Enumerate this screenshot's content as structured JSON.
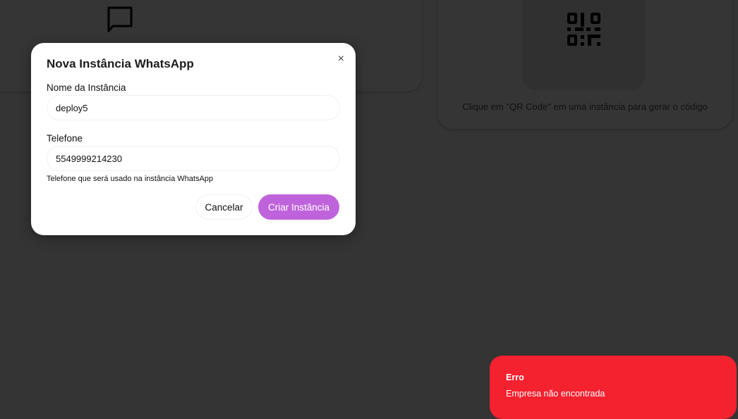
{
  "background": {
    "qr_hint": "Clique em \"QR Code\" em uma instância para gerar o código"
  },
  "modal": {
    "title": "Nova Instância WhatsApp",
    "name_label": "Nome da Instância",
    "name_value": "deploy5",
    "phone_label": "Telefone",
    "phone_value": "5549999214230",
    "phone_hint": "Telefone que será usado na instância WhatsApp",
    "close": "×",
    "cancel": "Cancelar",
    "create": "Criar Instância"
  },
  "toast": {
    "title": "Erro",
    "message": "Empresa não encontrada",
    "color": "#f4212f"
  },
  "colors": {
    "accent": "#bf63dc"
  }
}
